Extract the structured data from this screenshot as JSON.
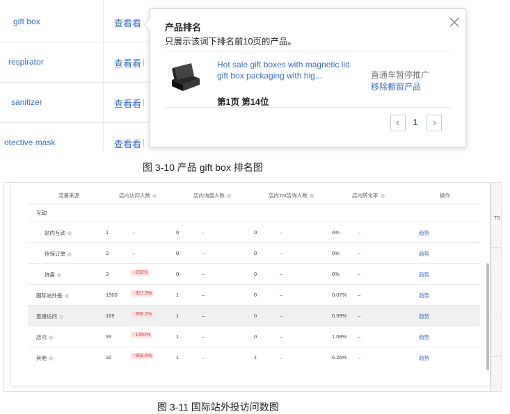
{
  "keywords": [
    {
      "name": "gift box",
      "view": "查看看"
    },
    {
      "name": "respirator",
      "view": "查看看"
    },
    {
      "name": "sanitizer",
      "view": "查看看"
    },
    {
      "name": "otective mask",
      "view": "查看看"
    }
  ],
  "separator": "|",
  "popover": {
    "title": "产品排名",
    "subtitle": "只展示该词下排名前10页的产品。",
    "product_title": "Hot sale gift boxes with magnetic lid gift box packaging with hig...",
    "rank": "第1页 第14位",
    "promo_status": "直通车暂停推广",
    "remove_label": "移除橱窗产品",
    "page": "1"
  },
  "caption1": "图 3-10 产品 gift box 排名图",
  "table": {
    "headers": [
      "流量来源",
      "店内访问人数",
      "店内询盘人数",
      "店内TM咨询人数",
      "店内转化率",
      "操作"
    ],
    "section": "互动",
    "rows": [
      {
        "source": "站内互动",
        "visitors": "1",
        "visitors_change": "–",
        "inquiries": "0",
        "inquiries_change": "–",
        "tm": "0",
        "tm_change": "–",
        "rate": "0%",
        "rate_change": "–",
        "action": "趋势"
      },
      {
        "source": "信保订单",
        "visitors": "2",
        "visitors_change": "–",
        "inquiries": "0",
        "inquiries_change": "–",
        "tm": "0",
        "tm_change": "–",
        "rate": "0%",
        "rate_change": "–",
        "action": "趋势"
      },
      {
        "source": "询盘",
        "visitors": "3",
        "visitors_change": "↑200%",
        "inquiries": "0",
        "inquiries_change": "–",
        "tm": "0",
        "tm_change": "–",
        "rate": "0%",
        "rate_change": "–",
        "action": "趋势"
      },
      {
        "source": "国际站外投",
        "visitors": "1500",
        "visitors_change": "↑927.3%",
        "inquiries": "1",
        "inquiries_change": "–",
        "tm": "0",
        "tm_change": "–",
        "rate": "0.07%",
        "rate_change": "–",
        "action": "趋势"
      },
      {
        "source": "直接访问",
        "visitors": "169",
        "visitors_change": "↑956.2%",
        "inquiries": "1",
        "inquiries_change": "–",
        "tm": "0",
        "tm_change": "–",
        "rate": "0.59%",
        "rate_change": "–",
        "action": "趋势"
      },
      {
        "source": "店内",
        "visitors": "93",
        "visitors_change": "↑1450%",
        "inquiries": "1",
        "inquiries_change": "–",
        "tm": "0",
        "tm_change": "–",
        "rate": "1.08%",
        "rate_change": "–",
        "action": "趋势"
      },
      {
        "source": "其他",
        "visitors": "32",
        "visitors_change": "↑966.6%",
        "inquiries": "1",
        "inquiries_change": "–",
        "tm": "1",
        "tm_change": "–",
        "rate": "6.25%",
        "rate_change": "–",
        "action": "趋势"
      }
    ],
    "side_text": "TS"
  },
  "caption2": "图 3-11 国际站外投访问数图",
  "colors": {
    "link": "#3b6fc4",
    "up_badge_text": "#e4393c",
    "up_badge_bg": "#fde3e3"
  }
}
